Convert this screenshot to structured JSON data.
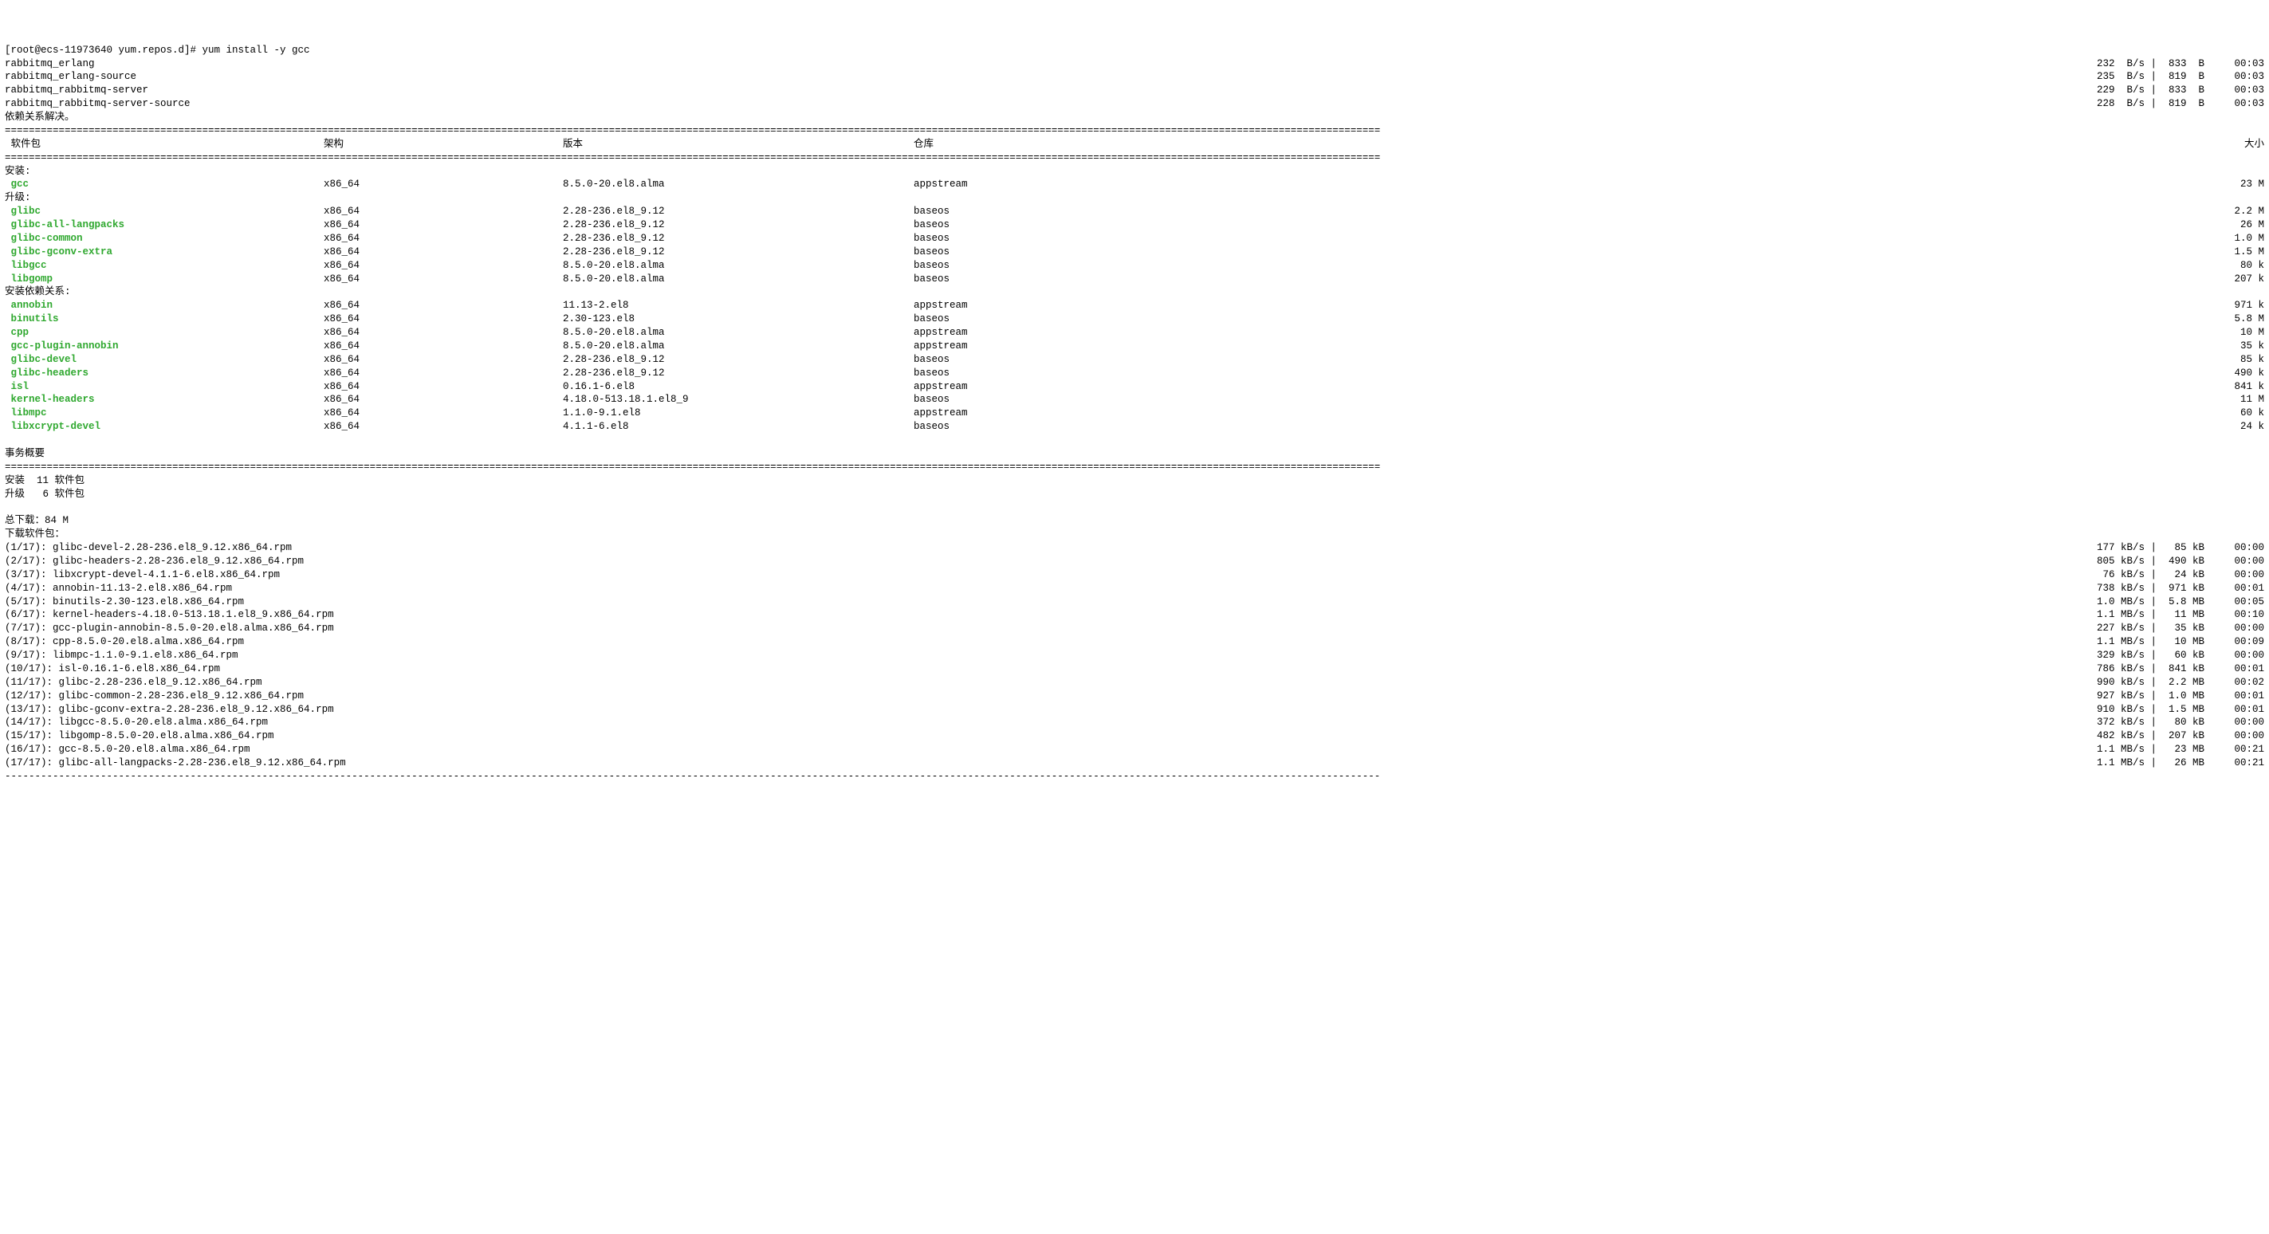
{
  "prompt": "[root@ecs-11973640 yum.repos.d]# yum install -y gcc",
  "repos": [
    {
      "name": "rabbitmq_erlang",
      "speed": "232  B/s",
      "size": "833  B",
      "time": "00:03"
    },
    {
      "name": "rabbitmq_erlang-source",
      "speed": "235  B/s",
      "size": "819  B",
      "time": "00:03"
    },
    {
      "name": "rabbitmq_rabbitmq-server",
      "speed": "229  B/s",
      "size": "833  B",
      "time": "00:03"
    },
    {
      "name": "rabbitmq_rabbitmq-server-source",
      "speed": "228  B/s",
      "size": "819  B",
      "time": "00:03"
    }
  ],
  "deps_resolved": "依赖关系解决。",
  "headers": {
    "pkg": " 软件包",
    "arch": "架构",
    "ver": "版本",
    "repo": "仓库",
    "size": "大小"
  },
  "install_label": "安装:",
  "upgrade_label": "升级:",
  "install_deps_label": "安装依赖关系:",
  "install": [
    {
      "name": "gcc",
      "arch": "x86_64",
      "ver": "8.5.0-20.el8.alma",
      "repo": "appstream",
      "size": "23 M"
    }
  ],
  "upgrade": [
    {
      "name": "glibc",
      "arch": "x86_64",
      "ver": "2.28-236.el8_9.12",
      "repo": "baseos",
      "size": "2.2 M"
    },
    {
      "name": "glibc-all-langpacks",
      "arch": "x86_64",
      "ver": "2.28-236.el8_9.12",
      "repo": "baseos",
      "size": "26 M"
    },
    {
      "name": "glibc-common",
      "arch": "x86_64",
      "ver": "2.28-236.el8_9.12",
      "repo": "baseos",
      "size": "1.0 M"
    },
    {
      "name": "glibc-gconv-extra",
      "arch": "x86_64",
      "ver": "2.28-236.el8_9.12",
      "repo": "baseos",
      "size": "1.5 M"
    },
    {
      "name": "libgcc",
      "arch": "x86_64",
      "ver": "8.5.0-20.el8.alma",
      "repo": "baseos",
      "size": "80 k"
    },
    {
      "name": "libgomp",
      "arch": "x86_64",
      "ver": "8.5.0-20.el8.alma",
      "repo": "baseos",
      "size": "207 k"
    }
  ],
  "install_deps": [
    {
      "name": "annobin",
      "arch": "x86_64",
      "ver": "11.13-2.el8",
      "repo": "appstream",
      "size": "971 k"
    },
    {
      "name": "binutils",
      "arch": "x86_64",
      "ver": "2.30-123.el8",
      "repo": "baseos",
      "size": "5.8 M"
    },
    {
      "name": "cpp",
      "arch": "x86_64",
      "ver": "8.5.0-20.el8.alma",
      "repo": "appstream",
      "size": "10 M"
    },
    {
      "name": "gcc-plugin-annobin",
      "arch": "x86_64",
      "ver": "8.5.0-20.el8.alma",
      "repo": "appstream",
      "size": "35 k"
    },
    {
      "name": "glibc-devel",
      "arch": "x86_64",
      "ver": "2.28-236.el8_9.12",
      "repo": "baseos",
      "size": "85 k"
    },
    {
      "name": "glibc-headers",
      "arch": "x86_64",
      "ver": "2.28-236.el8_9.12",
      "repo": "baseos",
      "size": "490 k"
    },
    {
      "name": "isl",
      "arch": "x86_64",
      "ver": "0.16.1-6.el8",
      "repo": "appstream",
      "size": "841 k"
    },
    {
      "name": "kernel-headers",
      "arch": "x86_64",
      "ver": "4.18.0-513.18.1.el8_9",
      "repo": "baseos",
      "size": "11 M"
    },
    {
      "name": "libmpc",
      "arch": "x86_64",
      "ver": "1.1.0-9.1.el8",
      "repo": "appstream",
      "size": "60 k"
    },
    {
      "name": "libxcrypt-devel",
      "arch": "x86_64",
      "ver": "4.1.1-6.el8",
      "repo": "baseos",
      "size": "24 k"
    }
  ],
  "summary_label": "事务概要",
  "summary_install": "安装  11 软件包",
  "summary_upgrade": "升级   6 软件包",
  "total_download": "总下载：84 M",
  "downloading_label": "下载软件包：",
  "downloads": [
    {
      "idx": "(1/17)",
      "file": "glibc-devel-2.28-236.el8_9.12.x86_64.rpm",
      "speed": "177 kB/s",
      "size": " 85 kB",
      "time": "00:00"
    },
    {
      "idx": "(2/17)",
      "file": "glibc-headers-2.28-236.el8_9.12.x86_64.rpm",
      "speed": "805 kB/s",
      "size": "490 kB",
      "time": "00:00"
    },
    {
      "idx": "(3/17)",
      "file": "libxcrypt-devel-4.1.1-6.el8.x86_64.rpm",
      "speed": " 76 kB/s",
      "size": " 24 kB",
      "time": "00:00"
    },
    {
      "idx": "(4/17)",
      "file": "annobin-11.13-2.el8.x86_64.rpm",
      "speed": "738 kB/s",
      "size": "971 kB",
      "time": "00:01"
    },
    {
      "idx": "(5/17)",
      "file": "binutils-2.30-123.el8.x86_64.rpm",
      "speed": "1.0 MB/s",
      "size": "5.8 MB",
      "time": "00:05"
    },
    {
      "idx": "(6/17)",
      "file": "kernel-headers-4.18.0-513.18.1.el8_9.x86_64.rpm",
      "speed": "1.1 MB/s",
      "size": " 11 MB",
      "time": "00:10"
    },
    {
      "idx": "(7/17)",
      "file": "gcc-plugin-annobin-8.5.0-20.el8.alma.x86_64.rpm",
      "speed": "227 kB/s",
      "size": " 35 kB",
      "time": "00:00"
    },
    {
      "idx": "(8/17)",
      "file": "cpp-8.5.0-20.el8.alma.x86_64.rpm",
      "speed": "1.1 MB/s",
      "size": " 10 MB",
      "time": "00:09"
    },
    {
      "idx": "(9/17)",
      "file": "libmpc-1.1.0-9.1.el8.x86_64.rpm",
      "speed": "329 kB/s",
      "size": " 60 kB",
      "time": "00:00"
    },
    {
      "idx": "(10/17)",
      "file": "isl-0.16.1-6.el8.x86_64.rpm",
      "speed": "786 kB/s",
      "size": "841 kB",
      "time": "00:01"
    },
    {
      "idx": "(11/17)",
      "file": "glibc-2.28-236.el8_9.12.x86_64.rpm",
      "speed": "990 kB/s",
      "size": "2.2 MB",
      "time": "00:02"
    },
    {
      "idx": "(12/17)",
      "file": "glibc-common-2.28-236.el8_9.12.x86_64.rpm",
      "speed": "927 kB/s",
      "size": "1.0 MB",
      "time": "00:01"
    },
    {
      "idx": "(13/17)",
      "file": "glibc-gconv-extra-2.28-236.el8_9.12.x86_64.rpm",
      "speed": "910 kB/s",
      "size": "1.5 MB",
      "time": "00:01"
    },
    {
      "idx": "(14/17)",
      "file": "libgcc-8.5.0-20.el8.alma.x86_64.rpm",
      "speed": "372 kB/s",
      "size": " 80 kB",
      "time": "00:00"
    },
    {
      "idx": "(15/17)",
      "file": "libgomp-8.5.0-20.el8.alma.x86_64.rpm",
      "speed": "482 kB/s",
      "size": "207 kB",
      "time": "00:00"
    },
    {
      "idx": "(16/17)",
      "file": "gcc-8.5.0-20.el8.alma.x86_64.rpm",
      "speed": "1.1 MB/s",
      "size": " 23 MB",
      "time": "00:21"
    },
    {
      "idx": "(17/17)",
      "file": "glibc-all-langpacks-2.28-236.el8_9.12.x86_64.rpm",
      "speed": "1.1 MB/s",
      "size": " 26 MB",
      "time": "00:21"
    }
  ]
}
